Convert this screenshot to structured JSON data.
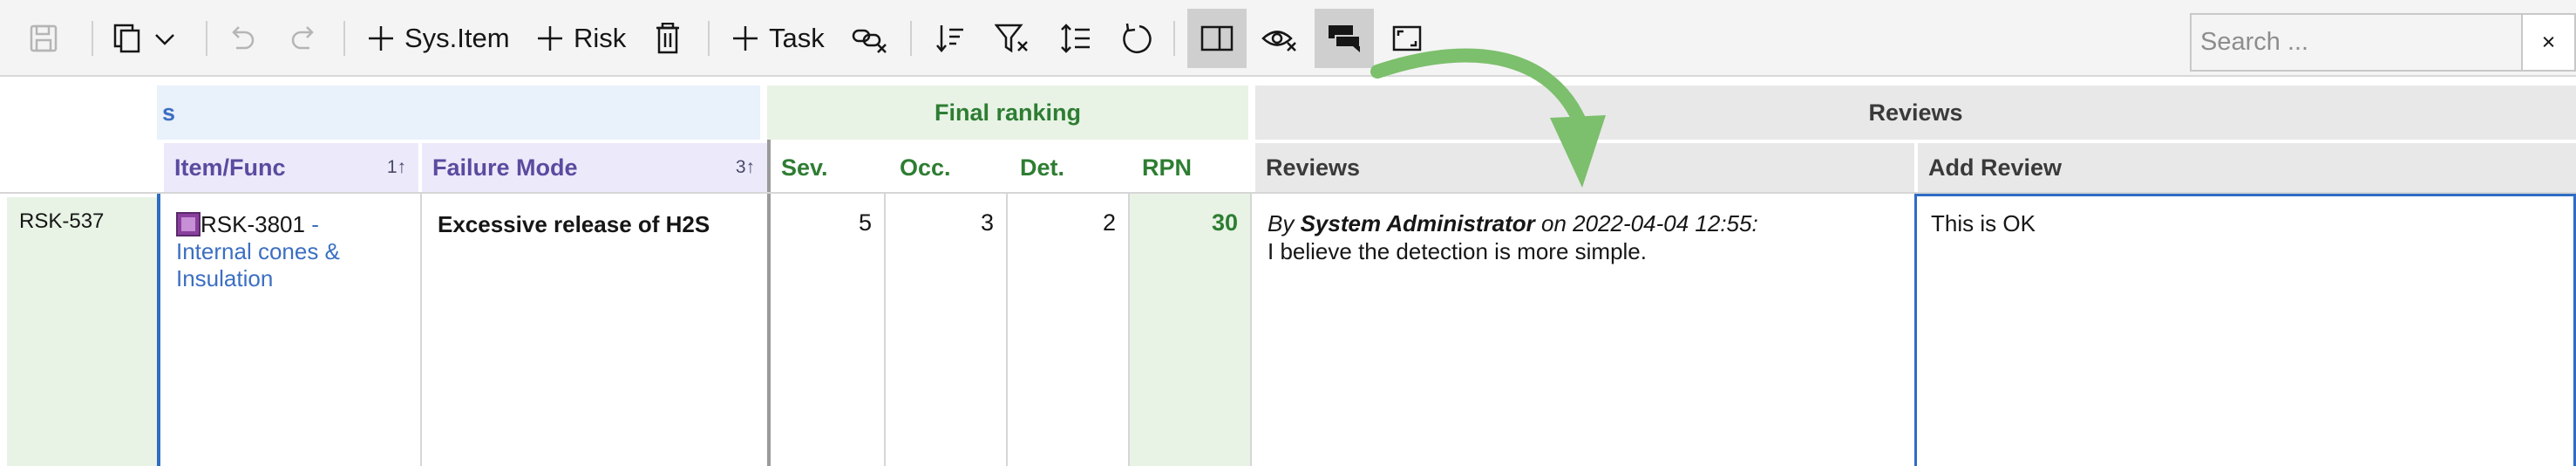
{
  "toolbar": {
    "buttons": [
      {
        "icon": "save-icon",
        "state": "disabled"
      },
      {
        "icon": "copy-icon",
        "state": "normal"
      },
      {
        "icon": "undo-icon",
        "state": "disabled"
      },
      {
        "icon": "redo-icon",
        "state": "disabled"
      },
      {
        "icon": "plus-icon",
        "label": "Sys.Item"
      },
      {
        "icon": "plus-icon",
        "label": "Risk"
      },
      {
        "icon": "trash-icon",
        "state": "normal"
      },
      {
        "icon": "plus-icon",
        "label": "Task"
      },
      {
        "icon": "unlink-icon",
        "state": "normal"
      },
      {
        "icon": "sort-icon",
        "state": "normal"
      },
      {
        "icon": "filter-clear-icon",
        "state": "normal"
      },
      {
        "icon": "row-height-icon",
        "state": "normal"
      },
      {
        "icon": "refresh-icon",
        "state": "normal"
      },
      {
        "icon": "split-view-icon",
        "state": "pressed"
      },
      {
        "icon": "hide-icon",
        "state": "normal"
      },
      {
        "icon": "comments-icon",
        "state": "pressed"
      },
      {
        "icon": "fullscreen-icon",
        "state": "normal"
      }
    ],
    "sys_item_label": "Sys.Item",
    "risk_label": "Risk",
    "task_label": "Task",
    "search_placeholder": "Search ...",
    "search_clear": "×"
  },
  "grid": {
    "groups": {
      "left_partial": "s",
      "final_ranking": "Final ranking",
      "reviews": "Reviews"
    },
    "columns": {
      "item_func": "Item/Func",
      "item_func_sort": "1↑",
      "failure_mode": "Failure Mode",
      "failure_mode_sort": "3↑",
      "sev": "Sev.",
      "occ": "Occ.",
      "det": "Det.",
      "rpn": "RPN",
      "reviews": "Reviews",
      "add_review": "Add Review"
    },
    "row": {
      "id": "RSK-537",
      "item_id": "RSK-3801",
      "item_sep": " -",
      "item_name": "Internal cones & Insulation",
      "failure_mode": "Excessive release of H2S",
      "sev": "5",
      "occ": "3",
      "det": "2",
      "rpn": "30",
      "review_by": "By",
      "review_author": "System Administrator",
      "review_on": "on 2022-04-04 12:55:",
      "review_text": "I believe the detection is more simple.",
      "add_review_text": "This is OK"
    }
  },
  "colors": {
    "toolbar_bg": "#f4f4f4",
    "green_header": "#e8f3e6",
    "green_text": "#2e7d32",
    "purple_header": "#ece9fb",
    "purple_text": "#5b4b9f",
    "blue_header": "#e9f1fb",
    "link_blue": "#3b6fc2",
    "grey_header": "#e8e8e8",
    "focus_blue": "#2f6cc4",
    "arrow_green": "#7cbf6c"
  }
}
